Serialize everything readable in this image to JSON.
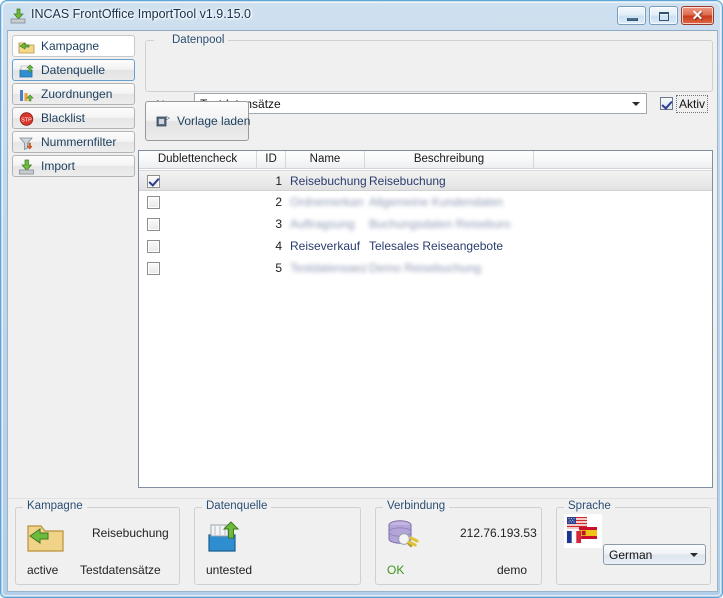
{
  "window": {
    "title": "INCAS FrontOffice ImportTool v1.9.15.0",
    "title_icon": "import-arrow-icon",
    "controls": {
      "minimize": "minimize-icon",
      "maximize": "maximize-icon",
      "close": "close-icon"
    }
  },
  "sidebar": {
    "items": [
      {
        "label": "Kampagne",
        "icon": "folder-campaign-icon",
        "state": "selected"
      },
      {
        "label": "Datenquelle",
        "icon": "datasource-icon",
        "state": "highlighted"
      },
      {
        "label": "Zuordnungen",
        "icon": "mapping-chart-icon",
        "state": "normal"
      },
      {
        "label": "Blacklist",
        "icon": "stop-sign-icon",
        "state": "normal"
      },
      {
        "label": "Nummernfilter",
        "icon": "funnel-filter-icon",
        "state": "normal"
      },
      {
        "label": "Import",
        "icon": "import-arrow-icon",
        "state": "normal"
      }
    ]
  },
  "datapool": {
    "group_title": "Datenpool",
    "group_icon": "key-icon",
    "name_label": "Name",
    "name_value": "Testdatensätze",
    "name_placeholder": "",
    "active_checkbox": {
      "label": "Aktiv",
      "checked": true
    }
  },
  "toolbar": {
    "load_template_label": "Vorlage laden",
    "load_template_icon": "load-template-icon"
  },
  "table": {
    "columns": [
      "Dublettencheck",
      "ID",
      "Name",
      "Beschreibung",
      ""
    ],
    "rows": [
      {
        "check": true,
        "id": "1",
        "name": "Reisebuchung",
        "desc": "Reisebuchung",
        "redacted": false,
        "selected": true
      },
      {
        "check": false,
        "id": "2",
        "name": "Ordnemerkan",
        "desc": "Allgemeine Kundendaten",
        "redacted": true,
        "selected": false
      },
      {
        "check": false,
        "id": "3",
        "name": "Auftragsung",
        "desc": "Buchungsdaten Reiseburo",
        "redacted": true,
        "selected": false
      },
      {
        "check": false,
        "id": "4",
        "name": "Reiseverkauf",
        "desc": "Telesales Reiseangebote",
        "redacted": false,
        "selected": false
      },
      {
        "check": false,
        "id": "5",
        "name": "Testdatensaez",
        "desc": "Demo Reisebuchung",
        "redacted": true,
        "selected": false
      }
    ]
  },
  "statusbar": {
    "kampagne": {
      "title": "Kampagne",
      "icon": "folder-campaign-icon",
      "name": "Reisebuchung",
      "state": "active",
      "datapool": "Testdatensätze"
    },
    "datenquelle": {
      "title": "Datenquelle",
      "icon": "datasource-icon",
      "state": "untested"
    },
    "verbindung": {
      "title": "Verbindung",
      "icon": "database-plug-icon",
      "host": "212.76.193.53",
      "state": "OK",
      "state_color": "#3d9620",
      "user": "demo"
    },
    "sprache": {
      "title": "Sprache",
      "icon": "flags-icon",
      "selected": "German"
    }
  }
}
